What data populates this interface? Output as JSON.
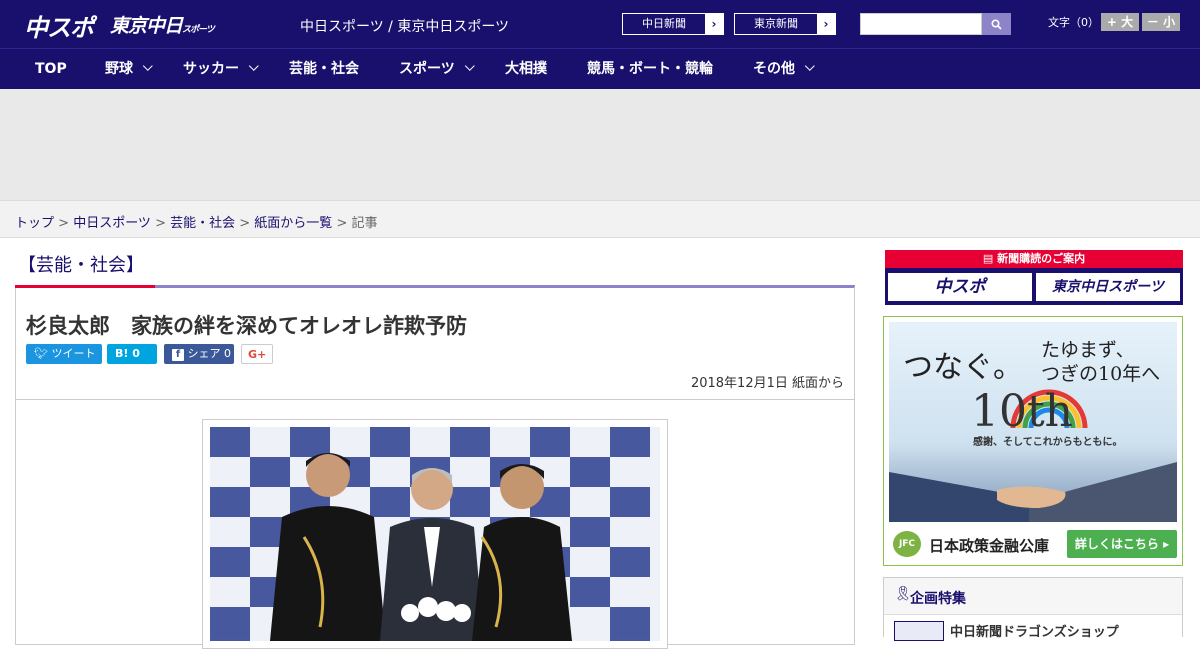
{
  "header": {
    "logo_main": "中スポ",
    "logo_tokyo": "東京中日",
    "logo_tokyo_suffix": "スポーツ",
    "site_name": "中日スポーツ / 東京中日スポーツ",
    "paper_links": [
      {
        "label": "中日新聞"
      },
      {
        "label": "東京新聞"
      }
    ],
    "font_size_label": "文字（0）",
    "font_bigger": "+ 大",
    "font_smaller": "－ 小"
  },
  "nav": {
    "items": [
      {
        "label": "TOP",
        "has_menu": false
      },
      {
        "label": "野球",
        "has_menu": true
      },
      {
        "label": "サッカー",
        "has_menu": true
      },
      {
        "label": "芸能・社会",
        "has_menu": false
      },
      {
        "label": "スポーツ",
        "has_menu": true
      },
      {
        "label": "大相撲",
        "has_menu": false
      },
      {
        "label": "競馬・ボート・競輪",
        "has_menu": false
      },
      {
        "label": "その他",
        "has_menu": true
      }
    ]
  },
  "breadcrumb": {
    "items": [
      "トップ",
      "中日スポーツ",
      "芸能・社会",
      "紙面から一覧"
    ],
    "current": "記事"
  },
  "article": {
    "category": "【芸能・社会】",
    "title": "杉良太郎　家族の絆を深めてオレオレ詐欺予防",
    "share": {
      "tweet": "ツイート",
      "hatena": "B!",
      "hatena_count": "0",
      "facebook": "シェア",
      "facebook_count": "0",
      "gplus": "G+"
    },
    "date": "2018年12月1日 紙面から"
  },
  "sidebar": {
    "subscribe_heading": "新聞購読のご案内",
    "subscribe_buttons": [
      "中スポ",
      "東京中日スポーツ"
    ],
    "ad": {
      "line1": "つなぐ。",
      "line2a": "たゆまず、",
      "line2b": "つぎの10年へ",
      "anniv": "10th",
      "thanks": "感謝、そしてこれからもともに。",
      "logo": "JFC",
      "org": "日本政策金融公庫",
      "cta": "詳しくはこちら ▸"
    },
    "feature_title": "企画特集",
    "feature_item": "中日新聞ドラゴンズショップ"
  },
  "colors": {
    "brand_navy": "#19106e",
    "accent_red": "#e60033",
    "accent_lavender": "#8c83c9",
    "twitter": "#1b95e0",
    "hatena": "#00a4de",
    "facebook": "#3b5998",
    "jfc_green": "#4caf50"
  }
}
